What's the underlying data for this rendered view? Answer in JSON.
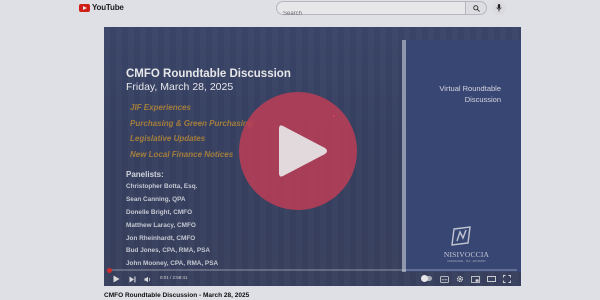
{
  "header": {
    "logo_text": "YouTube",
    "search_placeholder": "Search"
  },
  "player": {
    "slide": {
      "title": "CMFO Roundtable Discussion",
      "date": "Friday, March 28, 2025",
      "topics": [
        "JIF Experiences",
        "Purchasing & Green Purchasing",
        "Legislative Updates",
        "New Local Finance Notices"
      ],
      "panelists_heading": "Panelists:",
      "panelists": [
        "Christopher Botta, Esq.",
        "Sean Canning, QPA",
        "Donelle Bright, CMFO",
        "Matthew Laracy, CMFO",
        "Jon Rheinhardt, CMFO",
        "Bud Jones, CPA, RMA, PSA",
        "John Mooney, CPA, RMA, PSA"
      ],
      "side_title_line1": "Virtual Roundtable",
      "side_title_line2": "Discussion",
      "firm_name": "NISIVOCCIA",
      "firm_tagline": "ASSURANCE · TAX · ADVISORY"
    },
    "time_display": "0:01 / 2:58:41",
    "progress_fraction": 0.0001
  },
  "video": {
    "title": "CMFO Roundtable Discussion - March 28, 2025"
  },
  "colors": {
    "accent_red": "#e62117",
    "slide_bg": "#3b4563",
    "topic_gold": "#b58a3f",
    "play_button": "#ce425c"
  }
}
